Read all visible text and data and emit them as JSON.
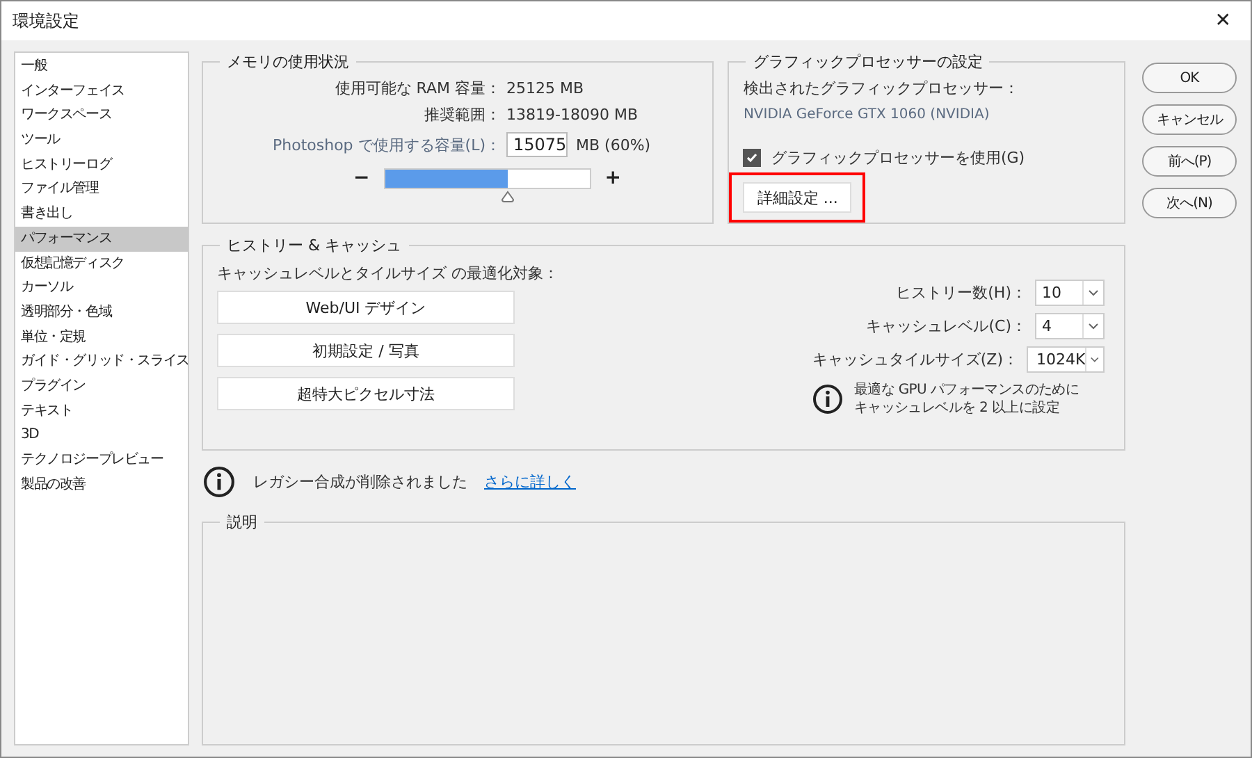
{
  "window": {
    "title": "環境設定",
    "close": "✕"
  },
  "sidebar": {
    "items": [
      {
        "label": "一般",
        "selected": false
      },
      {
        "label": "インターフェイス",
        "selected": false
      },
      {
        "label": "ワークスペース",
        "selected": false
      },
      {
        "label": "ツール",
        "selected": false
      },
      {
        "label": "ヒストリーログ",
        "selected": false
      },
      {
        "label": "ファイル管理",
        "selected": false
      },
      {
        "label": "書き出し",
        "selected": false
      },
      {
        "label": "パフォーマンス",
        "selected": true
      },
      {
        "label": "仮想記憶ディスク",
        "selected": false
      },
      {
        "label": "カーソル",
        "selected": false
      },
      {
        "label": "透明部分・色域",
        "selected": false
      },
      {
        "label": "単位・定規",
        "selected": false
      },
      {
        "label": "ガイド・グリッド・スライス",
        "selected": false
      },
      {
        "label": "プラグイン",
        "selected": false
      },
      {
        "label": "テキスト",
        "selected": false
      },
      {
        "label": "3D",
        "selected": false
      },
      {
        "label": "テクノロジープレビュー",
        "selected": false
      },
      {
        "label": "製品の改善",
        "selected": false
      }
    ]
  },
  "memory": {
    "title": "メモリの使用状況",
    "ram_label": "使用可能な RAM 容量：",
    "ram_value": "25125 MB",
    "range_label": "推奨範囲：",
    "range_value": "13819-18090 MB",
    "use_label": "Photoshop で使用する容量(L)：",
    "use_value": "15075",
    "use_unit": "MB (60%)",
    "minus": "−",
    "plus": "+",
    "level": 0.6
  },
  "gpu": {
    "title": "グラフィックプロセッサーの設定",
    "detected_label": "検出されたグラフィックプロセッサー：",
    "detected_value": "NVIDIA GeForce GTX 1060 (NVIDIA)",
    "use_gpu": {
      "label": "グラフィックプロセッサーを使用(G)",
      "checked": true
    },
    "advanced_button": {
      "label": "詳細設定 ...",
      "highlighted": true
    }
  },
  "history_cache": {
    "title": "ヒストリー & キャッシュ",
    "optimize_label": "キャッシュレベルとタイルサイズ の最適化対象：",
    "presets": [
      "Web/UI デザイン",
      "初期設定 / 写真",
      "超特大ピクセル寸法"
    ],
    "fields": [
      {
        "label": "ヒストリー数(H)：",
        "value": "10"
      },
      {
        "label": "キャッシュレベル(C)：",
        "value": "4"
      },
      {
        "label": "キャッシュタイルサイズ(Z)：",
        "value": "1024K"
      }
    ],
    "hint": [
      "最適な GPU パフォーマンスのために",
      "キャッシュレベルを 2 以上に設定"
    ]
  },
  "notice": {
    "text": "レガシー合成が削除されました",
    "link": "さらに詳しく"
  },
  "description": {
    "title": "説明"
  },
  "buttons": [
    "OK",
    "キャンセル",
    "前へ(P)",
    "次へ(N)"
  ]
}
